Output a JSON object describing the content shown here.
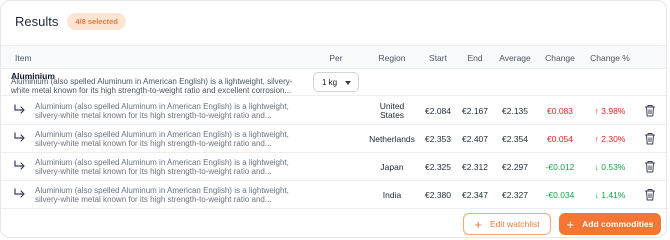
{
  "header": {
    "title": "Results",
    "badge": "4/8 selected"
  },
  "columns": {
    "item": "Item",
    "per": "Per",
    "region": "Region",
    "start": "Start",
    "end": "End",
    "average": "Average",
    "change": "Change",
    "change_pct": "Change %"
  },
  "group": {
    "name": "Aluminium",
    "description": "Aluminium (also spelled Aluminum in American English) is a lightweight, silvery-white metal known for its high strength-to-weight ratio and excellent corrosion...",
    "unit": "1 kg"
  },
  "rows": [
    {
      "description": "Aluminium (also spelled Aluminum in American English) is a lightweight, silvery-white metal known for its high strength-to-weight ratio and...",
      "region_line1": "United",
      "region_line2": "States",
      "start": "€2.084",
      "end": "€2.167",
      "average": "€2.135",
      "change": "€0.083",
      "change_pct": "3.98%",
      "direction": "up"
    },
    {
      "description": "Aluminium (also spelled Aluminum in American English) is a lightweight, silvery-white metal known for its high strength-to-weight ratio and...",
      "region": "Netherlands",
      "start": "€2.353",
      "end": "€2.407",
      "average": "€2.354",
      "change": "€0.054",
      "change_pct": "2.30%",
      "direction": "up"
    },
    {
      "description": "Aluminium (also spelled Aluminum in American English) is a lightweight, silvery-white metal known for its high strength-to-weight ratio and...",
      "region": "Japan",
      "start": "€2.325",
      "end": "€2.312",
      "average": "€2.297",
      "change": "-€0.012",
      "change_pct": "0.53%",
      "direction": "down"
    },
    {
      "description": "Aluminium (also spelled Aluminum in American English) is a lightweight, silvery-white metal known for its high strength-to-weight ratio and...",
      "region": "India",
      "start": "€2.380",
      "end": "€2.347",
      "average": "€2.327",
      "change": "-€0.034",
      "change_pct": "1.41%",
      "direction": "down"
    }
  ],
  "arrows": {
    "up": "↑",
    "down": "↓"
  },
  "actions": {
    "plus": "+",
    "edit_watchlist": "Edit watchlist",
    "add_commodities": "Add commodities"
  },
  "icons": {
    "row_indent": "subdirectory-arrow-icon",
    "delete": "trash-icon",
    "unit_dropdown": "chevron-down-icon"
  },
  "colors": {
    "accent": "#f57533",
    "negative": "#dc2626",
    "positive": "#16a34a"
  }
}
